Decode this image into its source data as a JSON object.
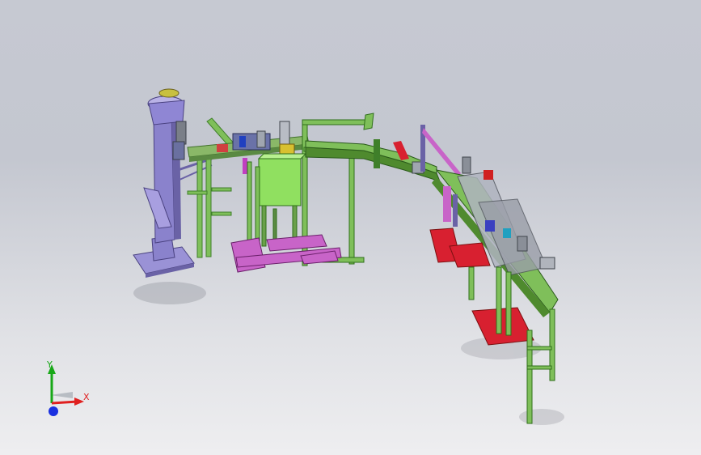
{
  "triad": {
    "x_label": "X",
    "y_label": "Y",
    "x_color": "#e02020",
    "y_color": "#18a818",
    "z_color": "#1a30e0"
  },
  "colors": {
    "frame_green": "#7fbf5a",
    "frame_dark_green": "#3f7f2a",
    "magenta": "#c864c8",
    "red": "#d82030",
    "lavender": "#9a92d6",
    "purple": "#7a6ad0",
    "tank_green": "#90e060",
    "steel": "#8c9098"
  }
}
